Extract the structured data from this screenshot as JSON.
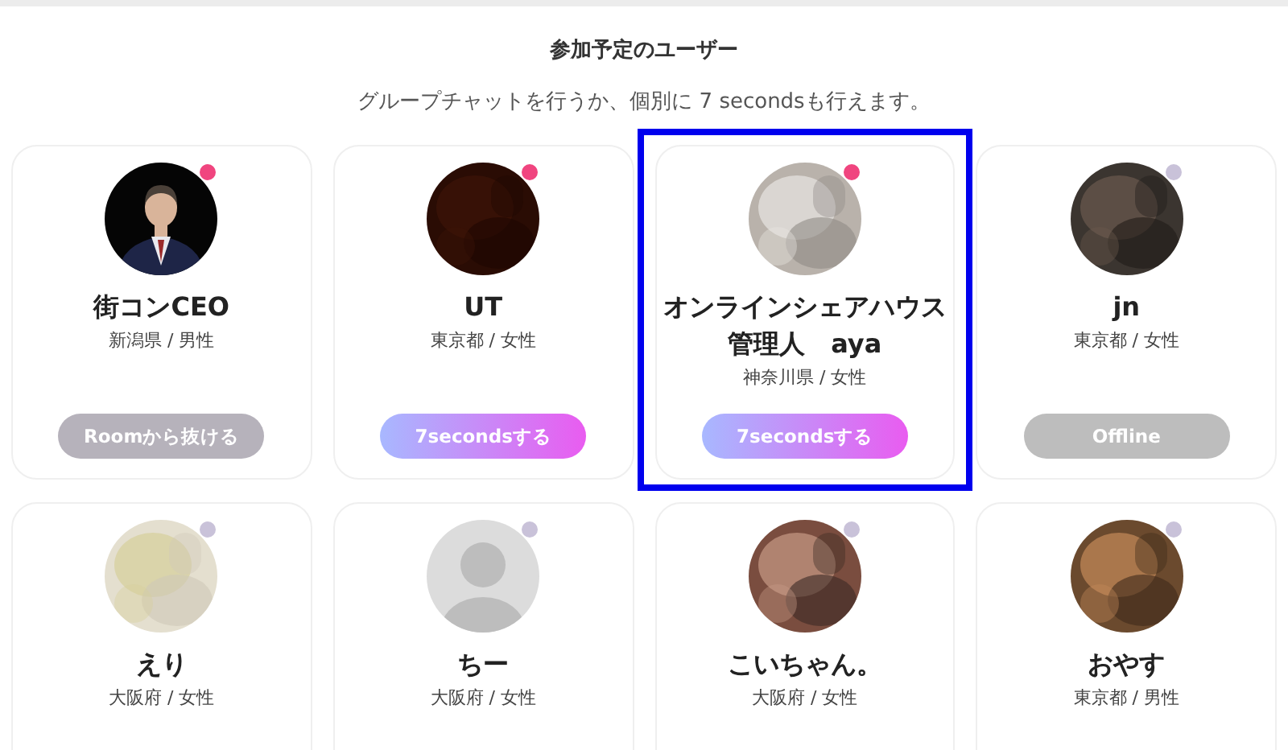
{
  "heading": "参加予定のユーザー",
  "subtitle": "グループチャットを行うか、個別に 7 secondsも行えます。",
  "users": [
    {
      "name": "街コンCEO",
      "location": "新潟県 / 男性",
      "kind": "figure",
      "color": "#f0457f",
      "highlighted": false,
      "button": {
        "kind": "leave",
        "label": "Roomから抜ける"
      }
    },
    {
      "name": "UT",
      "location": "東京都 / 女性",
      "kind": "picture",
      "color": "#f0457f",
      "highlighted": false,
      "button": {
        "kind": "seconds",
        "label": "7secondsする"
      }
    },
    {
      "name": "オンラインシェアハウス管理人　aya",
      "location": "神奈川県 / 女性",
      "kind": "picture",
      "color": "#f0457f",
      "highlighted": true,
      "button": {
        "kind": "seconds",
        "label": "7secondsする"
      }
    },
    {
      "name": "jn",
      "location": "東京都 / 女性",
      "kind": "picture",
      "color": "#c9c2d9",
      "highlighted": false,
      "button": {
        "kind": "offline",
        "label": "Offline"
      }
    },
    {
      "name": "えり",
      "location": "大阪府 / 女性",
      "kind": "picture",
      "color": "#c9c2d9",
      "highlighted": false
    },
    {
      "name": "ちー",
      "location": "大阪府 / 女性",
      "kind": "default",
      "color": "#c9c2d9",
      "highlighted": false
    },
    {
      "name": "こいちゃん。",
      "location": "大阪府 / 女性",
      "kind": "picture",
      "color": "#c9c2d9",
      "highlighted": false
    },
    {
      "name": "おやす",
      "location": "東京都 / 男性",
      "kind": "picture",
      "color": "#c9c2d9",
      "highlighted": false
    }
  ]
}
